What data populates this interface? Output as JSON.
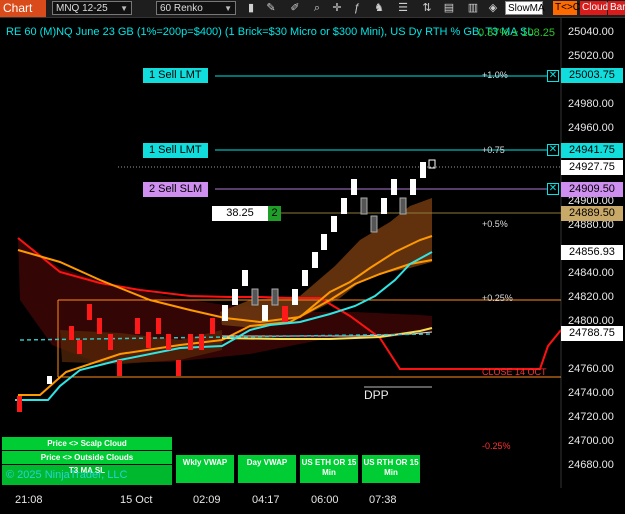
{
  "toolbar": {
    "title": "Chart",
    "instrument": "MNQ 12-25",
    "interval": "60 Renko",
    "indicator": "SlowMA",
    "tc_label": "T<>C",
    "cloud_label": "Cloud",
    "bar_label": "Bar"
  },
  "chart": {
    "title": "RE 60 (M)NQ June 23 GB (1%=200p=$400) (1 Brick=$30 Micro or $300 Mini), US Dy RTH % GB, T3 MA SL",
    "title_pct": "0.87% ± 108.25",
    "colors": {
      "accent": "#00e5e5",
      "bull": "#ffffff",
      "bear": "#ff1a1a",
      "up_line": "#00e5e5",
      "ma": "#ff9900",
      "cloud": "#7a3c10"
    }
  },
  "orders": [
    {
      "label": "1 Sell LMT",
      "price": "25003.75"
    },
    {
      "label": "1 Sell LMT",
      "price": "24941.75"
    },
    {
      "label": "2 Sell SLM",
      "price": "24909.50"
    }
  ],
  "position": {
    "qty": "38.25",
    "count": "2",
    "price": "24889.50"
  },
  "price_boxes": {
    "last": "24927.75",
    "indicator1": "24856.93",
    "indicator2": "24788.75"
  },
  "price_axis": [
    "25040.00",
    "25020.00",
    "25000.00",
    "24980.00",
    "24960.00",
    "24940.00",
    "24920.00",
    "24900.00",
    "24880.00",
    "24860.00",
    "24840.00",
    "24820.00",
    "24800.00",
    "24780.00",
    "24760.00",
    "24740.00",
    "24720.00",
    "24700.00",
    "24680.00"
  ],
  "level_labels": {
    "p1": "+1.0%",
    "p075": "+0.75",
    "p05": "+0.5%",
    "p025": "+0.25%",
    "close": "CLOSE 14 OCT",
    "m025": "-0.25%",
    "dpp": "DPP"
  },
  "time_axis": [
    "21:08",
    "15 Oct",
    "02:09",
    "04:17",
    "06:00",
    "07:38"
  ],
  "buttons": {
    "scalp": "Price <> Scalp Cloud",
    "outside": "Price <> Outside Clouds",
    "t3": "T3 MA SL",
    "wkly": "Wkly VWAP",
    "day": "Day VWAP",
    "eth": "US ETH OR 15 Min",
    "rth": "US RTH OR 15 Min"
  },
  "copyright": "© 2025 NinjaTrader, LLC"
}
